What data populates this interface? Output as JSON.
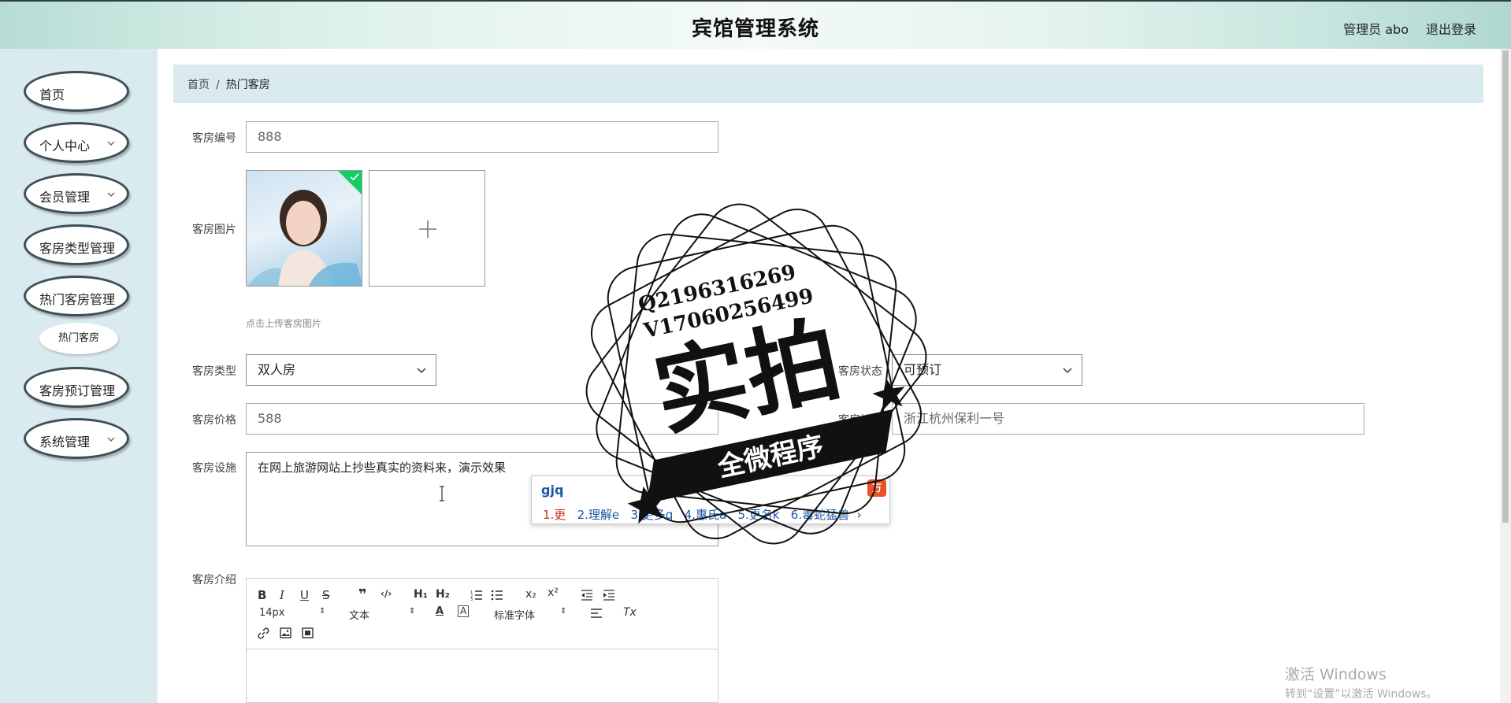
{
  "header": {
    "title": "宾馆管理系统",
    "user": "管理员 abo",
    "logout": "退出登录"
  },
  "sidebar": {
    "items": [
      {
        "label": "首页",
        "has_children": false
      },
      {
        "label": "个人中心",
        "has_children": true
      },
      {
        "label": "会员管理",
        "has_children": true
      },
      {
        "label": "客房类型管理",
        "has_children": false
      },
      {
        "label": "热门客房管理",
        "has_children": false
      },
      {
        "label": "客房预订管理",
        "has_children": false
      },
      {
        "label": "系统管理",
        "has_children": true
      }
    ],
    "sub_item": "热门客房"
  },
  "breadcrumb": {
    "home": "首页",
    "separator": "/",
    "current": "热门客房"
  },
  "form": {
    "room_no_label": "客房编号",
    "room_no_value": "888",
    "room_img_label": "客房图片",
    "upload_hint": "点击上传客房图片",
    "room_type_label": "客房类型",
    "room_type_value": "双人房",
    "room_status_label": "客房状态",
    "room_status_value": "可预订",
    "price_label": "客房价格",
    "price_value": "588",
    "address_label": "客房地址",
    "address_value": "浙江杭州保利一号",
    "facilities_label": "客房设施",
    "facilities_value": "在网上旅游网站上抄些真实的资料来，演示效果",
    "intro_label": "客房介绍"
  },
  "editor": {
    "font_size": "14px",
    "text_type": "文本",
    "font_family": "标准字体"
  },
  "ime": {
    "composition": "gjq",
    "candidates": [
      "1.更",
      "2.理解e",
      "3.更多q",
      "4.惠氏a",
      "5.更名k",
      "6.毒蛇猛兽"
    ],
    "logo": "万"
  },
  "watermark": {
    "qq": "Q2196316269",
    "wechat": "V17060256499",
    "big": "实拍",
    "banner": "全微程序"
  },
  "windows": {
    "line1": "激活 Windows",
    "line2": "转到“设置”以激活 Windows。"
  },
  "colors": {
    "sidebar_bg": "#d9ebee",
    "nav_border": "#3f4f57",
    "ime_text": "#1a56a8"
  }
}
